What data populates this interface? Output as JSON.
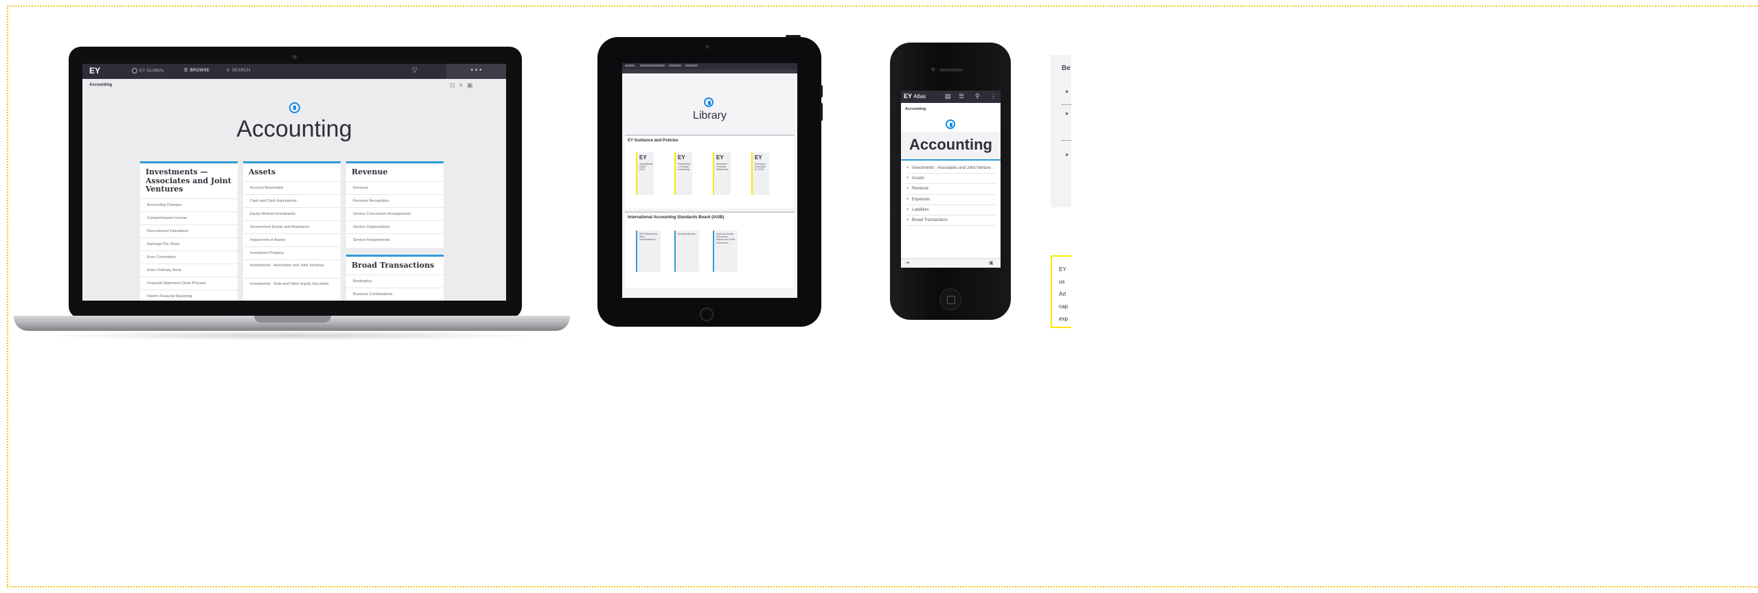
{
  "laptop": {
    "brand": "EY",
    "topbar": {
      "global": "EY GLOBAL",
      "browse": "BROWSE",
      "search": "SEARCH",
      "more": "• • •"
    },
    "breadcrumb": "Accounting",
    "title": "Accounting",
    "columns": [
      {
        "heading": "Investments — Associates and Joint Ventures",
        "items": [
          "Accounting Changes",
          "Comprehensive Income",
          "Discontinued Operations",
          "Earnings Per Share",
          "Error Corrections",
          "Extra Ordinary Items",
          "Financial Statement Close Process",
          "Interim Financial Reporting"
        ]
      },
      {
        "heading": "Assets",
        "items": [
          "Account Receivable",
          "Cash and Cash Equivalents",
          "Equity Method Investments",
          "Government Grants and Assistance",
          "Impairment of Assets",
          "Investment Property",
          "Investments - Associates and Joint Ventures",
          "Investments - Debt and Other Equity Securities"
        ]
      },
      {
        "heading": "Revenue",
        "items": [
          "Revenue",
          "Revenue Recognition",
          "Service Concession Arrangements",
          "Service Organizations",
          "Service Requirements"
        ]
      },
      {
        "heading": "Broad Transactions",
        "items": [
          "Bankruptcy",
          "Business Combinations"
        ]
      }
    ]
  },
  "tablet": {
    "title": "Library",
    "section1": "EY Guidance and Policies",
    "tiles1": [
      {
        "logo": "EY",
        "caption": "International GAAP 2016"
      },
      {
        "logo": "EY",
        "caption": "Publications & Thought Leadership"
      },
      {
        "logo": "EY",
        "caption": "Illustrative Financial Statements"
      },
      {
        "logo": "EY",
        "caption": "Disclosure Checklists for IFRS"
      }
    ],
    "section2": "International Accounting Standards Board (IASB)",
    "tiles2": [
      {
        "caption": "IFRS (Standards, IEDs, Interpretations)"
      },
      {
        "caption": "Meeting Minutes"
      },
      {
        "caption": "Exposure Drafts, Discussion Papers and Other Documents"
      }
    ]
  },
  "phone": {
    "brand": "EY",
    "app": "Atlas",
    "breadcrumb": "Accounting",
    "title": "Accounting",
    "items": [
      "Investments - Associates and Joint Venture",
      "Assets",
      "Revenue",
      "Expenses",
      "Liabilities",
      "Broad Transactions"
    ]
  },
  "side": {
    "title": "Be",
    "note_lines": [
      "EY",
      "us",
      "Art",
      "cap",
      "exp"
    ]
  }
}
